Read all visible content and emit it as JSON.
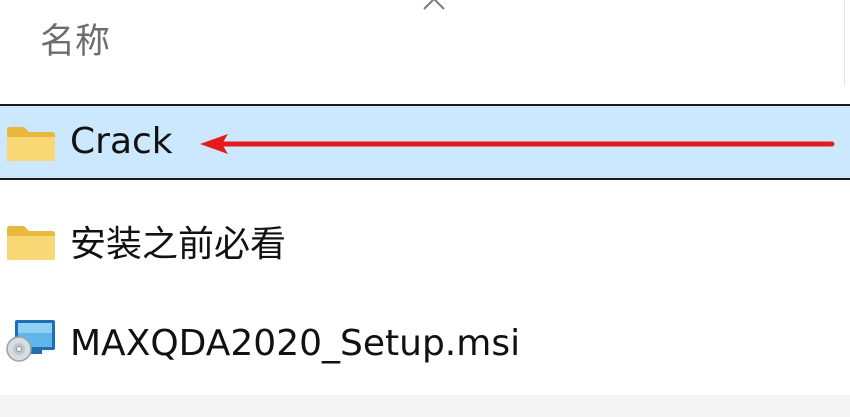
{
  "header": {
    "name_column_label": "名称"
  },
  "rows": [
    {
      "label": "Crack",
      "icon": "folder-icon",
      "selected": true
    },
    {
      "label": "安装之前必看",
      "icon": "folder-icon",
      "selected": false
    },
    {
      "label": "MAXQDA2020_Setup.msi",
      "icon": "msi-installer-icon",
      "selected": false
    }
  ],
  "colors": {
    "selection_background": "#cce8ff",
    "annotation_arrow": "#e31b1b",
    "folder_yellow": "#f8d775"
  }
}
